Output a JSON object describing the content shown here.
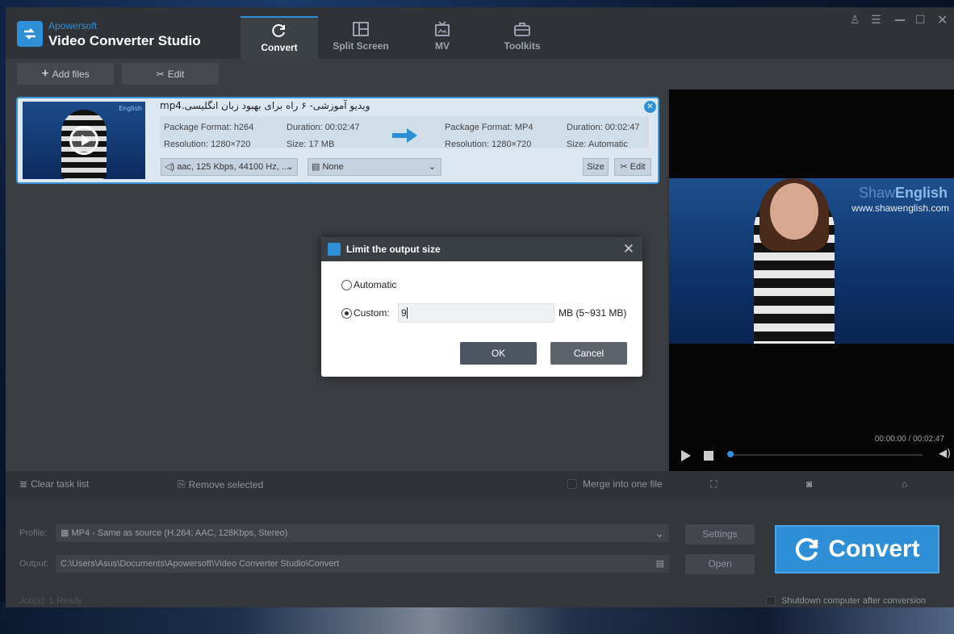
{
  "app": {
    "brand_small": "Apowersoft",
    "title": "Video Converter Studio"
  },
  "tabs": [
    {
      "label": "Convert",
      "icon": "refresh-icon",
      "active": true
    },
    {
      "label": "Split Screen",
      "icon": "split-screen-icon"
    },
    {
      "label": "MV",
      "icon": "tv-icon"
    },
    {
      "label": "Toolkits",
      "icon": "toolbox-icon"
    }
  ],
  "toolbar": {
    "add_files": "Add files",
    "edit": "Edit"
  },
  "task": {
    "filename": "ویدیو آموزشی- ۶ راه برای بهبود زبان انگلیسی.mp4",
    "src_format": "Package Format: h264",
    "src_resolution": "Resolution: 1280×720",
    "src_duration": "Duration: 00:02:47",
    "src_size": "Size: 17 MB",
    "dst_format": "Package Format: MP4",
    "dst_resolution": "Resolution: 1280×720",
    "dst_duration": "Duration: 00:02:47",
    "dst_size": "Size: Automatic",
    "audio": "aac, 125 Kbps, 44100 Hz, ...",
    "subtitle": "None",
    "size_btn": "Size",
    "edit_btn": "Edit",
    "thumb_watermark": "English"
  },
  "dialog": {
    "title": "Limit the output size",
    "automatic": "Automatic",
    "custom": "Custom:",
    "value": "9",
    "unit": "MB (5~931 MB)",
    "ok": "OK",
    "cancel": "Cancel"
  },
  "preview": {
    "watermark1": "English",
    "watermark1_prefix": "Shaw",
    "watermark2": "www.shawenglish.com",
    "time": "00:00:00 / 00:02:47"
  },
  "actions": {
    "clear": "Clear task list",
    "remove": "Remove selected",
    "merge": "Merge into one file"
  },
  "profile": {
    "profile_label": "Profile:",
    "profile_value": "MP4 - Same as source (H.264; AAC, 128Kbps, Stereo)",
    "output_label": "Output:",
    "output_value": "C:\\Users\\Asus\\Documents\\Apowersoft\\Video Converter Studio\\Convert",
    "settings": "Settings",
    "open": "Open",
    "convert": "Convert",
    "status": "Job(s): 1   Ready",
    "shutdown": "Shutdown computer after conversion"
  },
  "colors": {
    "accent": "#2e8fd6",
    "dark": "#33363b"
  }
}
